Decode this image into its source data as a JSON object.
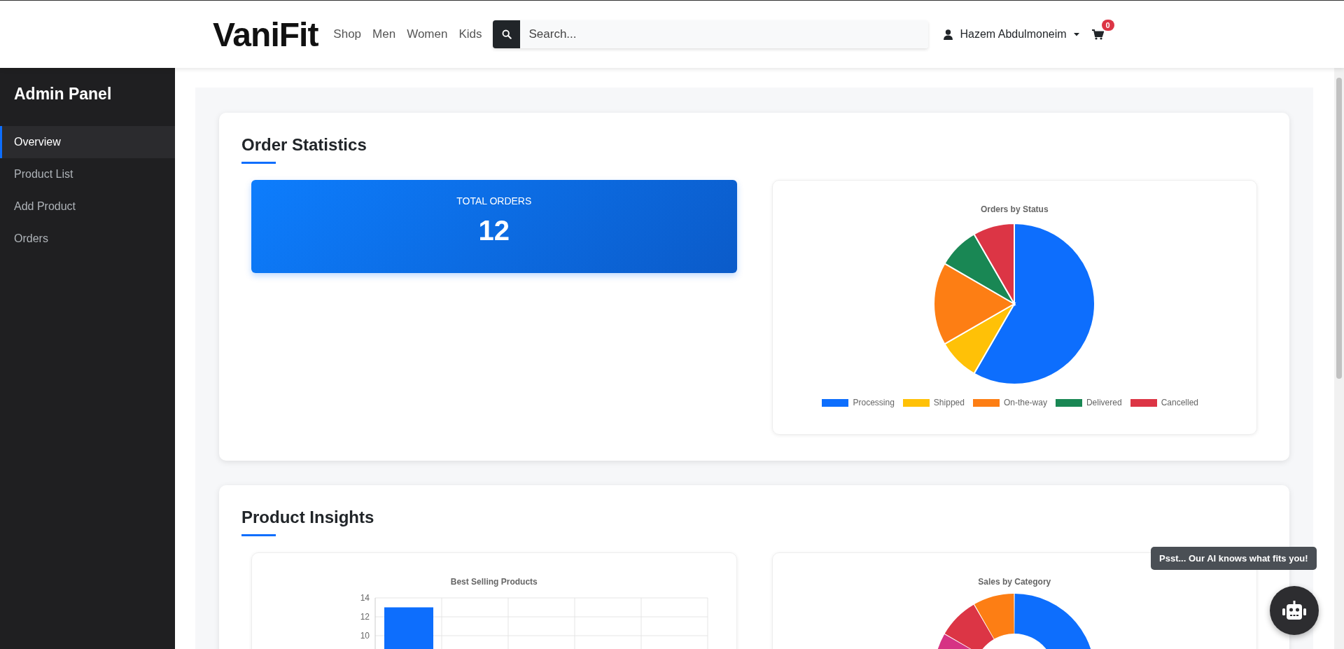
{
  "header": {
    "logo": "VaniFit",
    "nav": [
      "Shop",
      "Men",
      "Women",
      "Kids"
    ],
    "search": {
      "placeholder": "Search..."
    },
    "user": "Hazem Abdulmoneim",
    "cart_count": "0"
  },
  "sidebar": {
    "title": "Admin Panel",
    "items": [
      {
        "label": "Overview",
        "selected": true
      },
      {
        "label": "Product List",
        "selected": false
      },
      {
        "label": "Add Product",
        "selected": false
      },
      {
        "label": "Orders",
        "selected": false
      }
    ]
  },
  "order_statistics": {
    "title": "Order Statistics",
    "total_orders": {
      "label": "TOTAL ORDERS",
      "value": "12"
    },
    "chart_data": {
      "type": "pie",
      "title": "Orders by Status",
      "categories": [
        "Processing",
        "Shipped",
        "On-the-way",
        "Delivered",
        "Cancelled"
      ],
      "values": [
        58.34,
        8.33,
        16.67,
        8.33,
        8.33
      ],
      "colors": [
        "#0d6efd",
        "#ffc107",
        "#fd7e14",
        "#198754",
        "#dc3545"
      ]
    }
  },
  "product_insights": {
    "title": "Product Insights",
    "best_selling": {
      "chart_data": {
        "type": "bar",
        "title": "Best Selling Products",
        "values": [
          13,
          null,
          null,
          null,
          null
        ],
        "ylim": [
          8,
          14
        ],
        "yticks": [
          10,
          12,
          14
        ],
        "color": "#0d6efd"
      }
    },
    "sales_by_category": {
      "title": "Sales by Category"
    }
  },
  "assistant": {
    "tooltip": "Psst... Our AI knows what fits you!"
  }
}
